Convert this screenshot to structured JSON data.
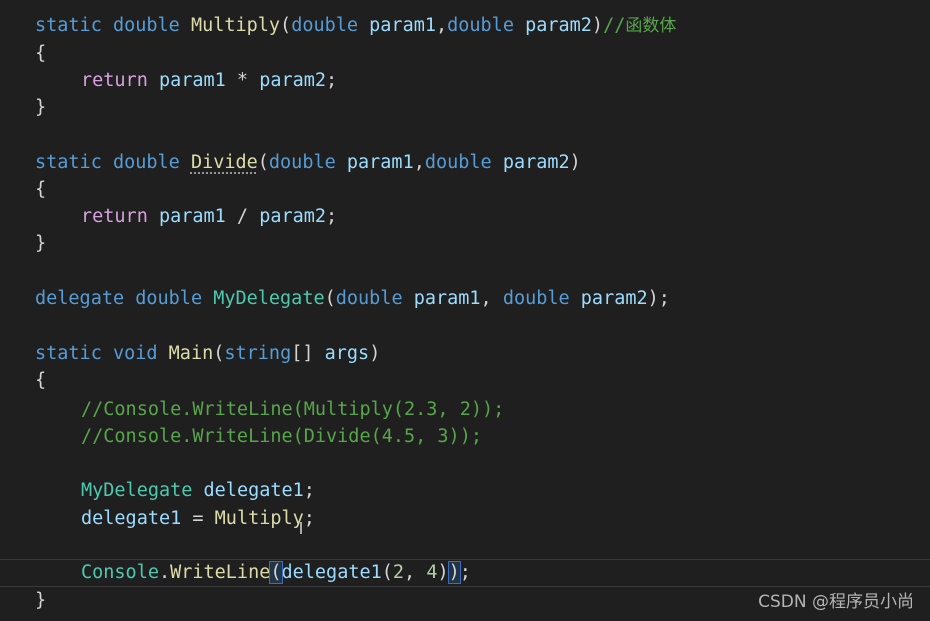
{
  "code": {
    "multiply": {
      "kw_static": "static",
      "kw_double": "double",
      "name": "Multiply",
      "open_paren": "(",
      "p1_type": "double",
      "p1_name": "param1",
      "comma": ",",
      "p2_type": "double",
      "p2_name": "param2",
      "close_paren": ")",
      "comment": "//函数体",
      "open_brace": "{",
      "kw_return": "return",
      "expr_left": "param1",
      "operator": " * ",
      "expr_right": "param2",
      "semicolon": ";",
      "close_brace": "}"
    },
    "divide": {
      "kw_static": "static",
      "kw_double": "double",
      "name": "Divide",
      "open_paren": "(",
      "p1_type": "double",
      "p1_name": "param1",
      "comma": ",",
      "p2_type": "double",
      "p2_name": "param2",
      "close_paren": ")",
      "open_brace": "{",
      "kw_return": "return",
      "expr_left": "param1",
      "operator": " / ",
      "expr_right": "param2",
      "semicolon": ";",
      "close_brace": "}"
    },
    "delegate_decl": {
      "kw_delegate": "delegate",
      "kw_double": "double",
      "name": "MyDelegate",
      "open_paren": "(",
      "p1_type": "double",
      "p1_name": "param1",
      "comma": ", ",
      "p2_type": "double",
      "p2_name": "param2",
      "close": ");"
    },
    "main": {
      "kw_static": "static",
      "kw_void": "void",
      "name": "Main",
      "open_paren": "(",
      "arg_type": "string",
      "brackets": "[]",
      "arg_name": "args",
      "close_paren": ")",
      "open_brace": "{",
      "comment1": "//Console.WriteLine(Multiply(2.3, 2));",
      "comment2": "//Console.WriteLine(Divide(4.5, 3));",
      "var_type": "MyDelegate",
      "var_name": "delegate1",
      "semicolon": ";",
      "assign_target": "delegate1",
      "assign_op": " = ",
      "assign_value": "Multiply",
      "console": "Console",
      "dot": ".",
      "writeline": "WriteLine",
      "call_open": "(",
      "call_name": "delegate1",
      "inner_open": "(",
      "num1": "2",
      "arg_sep": ", ",
      "num2": "4",
      "inner_close": ")",
      "call_close": ")",
      "close_brace": "}"
    }
  },
  "watermark": "CSDN @程序员小尚",
  "colors": {
    "background": "#1f1f1f",
    "keyword": "#569cd6",
    "control_keyword": "#d8a0df",
    "function": "#dcdcaa",
    "type": "#4ec9b0",
    "parameter": "#9cdcfe",
    "number": "#b5cea8",
    "comment": "#57a64a"
  }
}
